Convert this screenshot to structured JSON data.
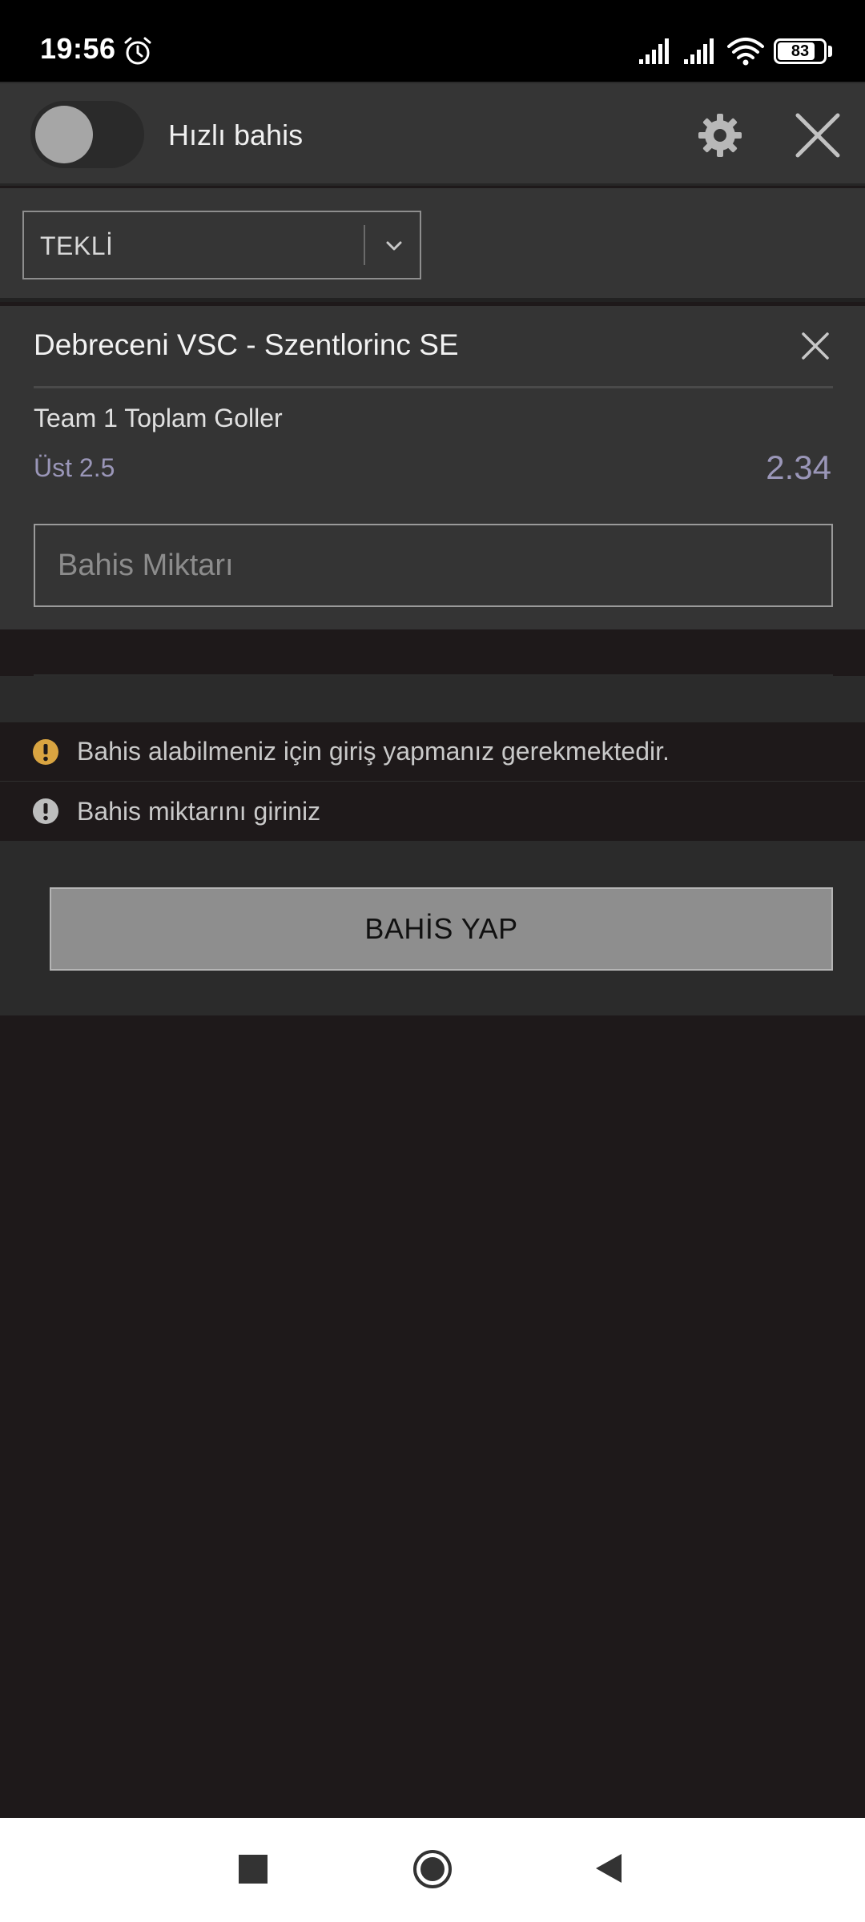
{
  "status_bar": {
    "time": "19:56",
    "battery_level": "83",
    "battery_fraction": 0.83,
    "icons": [
      "alarm-icon",
      "signal-icon",
      "signal-icon",
      "wifi-icon",
      "battery-icon"
    ]
  },
  "header": {
    "quick_bet_label": "Hızlı bahis",
    "quick_bet_enabled": false,
    "icons": [
      "gear-icon",
      "close-icon"
    ]
  },
  "bet_type": {
    "selected": "TEKLİ"
  },
  "bet_slip": {
    "match": "Debreceni VSC - Szentlorinc SE",
    "market": "Team 1 Toplam Goller",
    "selection": "Üst 2.5",
    "odds": "2.34",
    "stake_placeholder": "Bahis Miktarı"
  },
  "warnings": [
    {
      "text": "Bahis alabilmeniz için giriş yapmanız gerekmektedir.",
      "color": "#d9a441"
    },
    {
      "text": "Bahis miktarını giriniz",
      "color": "#bdbdbd"
    }
  ],
  "actions": {
    "place_bet_label": "BAHİS YAP"
  },
  "colors": {
    "background": "#1e191a",
    "panel": "#353535",
    "odds_accent": "#9a96b8",
    "warning_accent": "#d9a441",
    "button": "#8e8e8e"
  },
  "nav_bar": {
    "icons": [
      "recents-icon",
      "home-icon",
      "back-icon"
    ]
  }
}
